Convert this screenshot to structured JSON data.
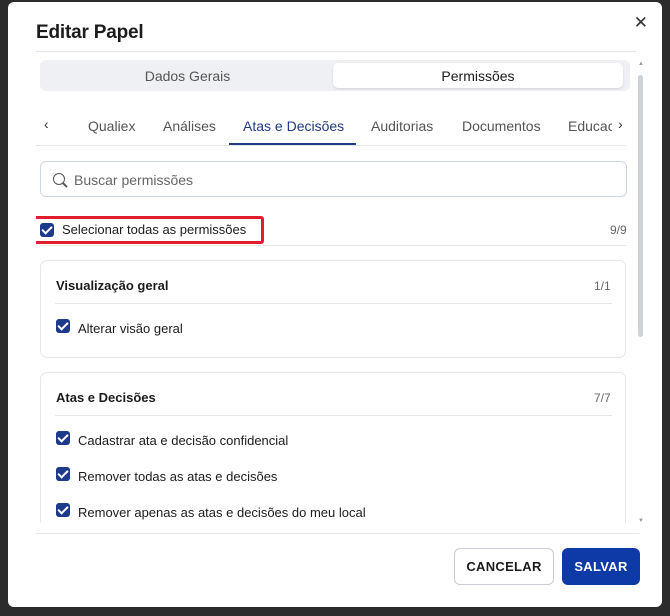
{
  "dialog": {
    "title": "Editar Papel"
  },
  "segments": [
    {
      "label": "Dados Gerais",
      "active": false
    },
    {
      "label": "Permissões",
      "active": true
    }
  ],
  "tabs": [
    {
      "label": "Qualiex"
    },
    {
      "label": "Análises"
    },
    {
      "label": "Atas e Decisões",
      "active": true
    },
    {
      "label": "Auditorias"
    },
    {
      "label": "Documentos"
    },
    {
      "label": "Educac"
    }
  ],
  "search": {
    "placeholder": "Buscar permissões",
    "value": ""
  },
  "select_all": {
    "label": "Selecionar todas as permissões",
    "count": "9/9",
    "checked": true
  },
  "groups": [
    {
      "title": "Visualização geral",
      "count": "1/1",
      "items": [
        {
          "label": "Alterar visão geral",
          "checked": true
        }
      ]
    },
    {
      "title": "Atas e Decisões",
      "count": "7/7",
      "items": [
        {
          "label": "Cadastrar ata e decisão confidencial",
          "checked": true
        },
        {
          "label": "Remover todas as atas e decisões",
          "checked": true
        },
        {
          "label": "Remover apenas as atas e decisões do meu local",
          "checked": true
        }
      ]
    }
  ],
  "footer": {
    "cancel_label": "CANCELAR",
    "save_label": "SALVAR"
  },
  "colors": {
    "accent": "#1e3a8a",
    "save": "#0d3aa6",
    "highlight": "#e11d2d"
  }
}
